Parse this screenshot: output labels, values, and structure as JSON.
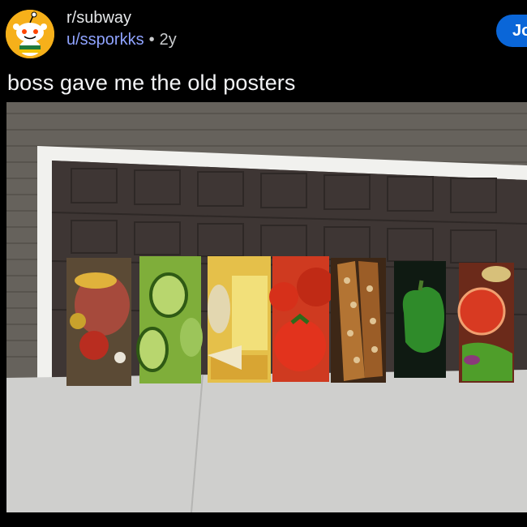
{
  "subreddit": {
    "name": "r/subway"
  },
  "author": {
    "username": "u/ssporkks",
    "separator": "•",
    "age": "2y"
  },
  "actions": {
    "join_label": "Jo"
  },
  "post": {
    "title": "boss gave me the old posters"
  },
  "icons": {
    "avatar": "reddit-snoo-avatar-icon"
  },
  "colors": {
    "background": "#000000",
    "accent": "#0a66d8",
    "username": "#8fa3ff",
    "avatar_bg": "#f6b01a"
  }
}
